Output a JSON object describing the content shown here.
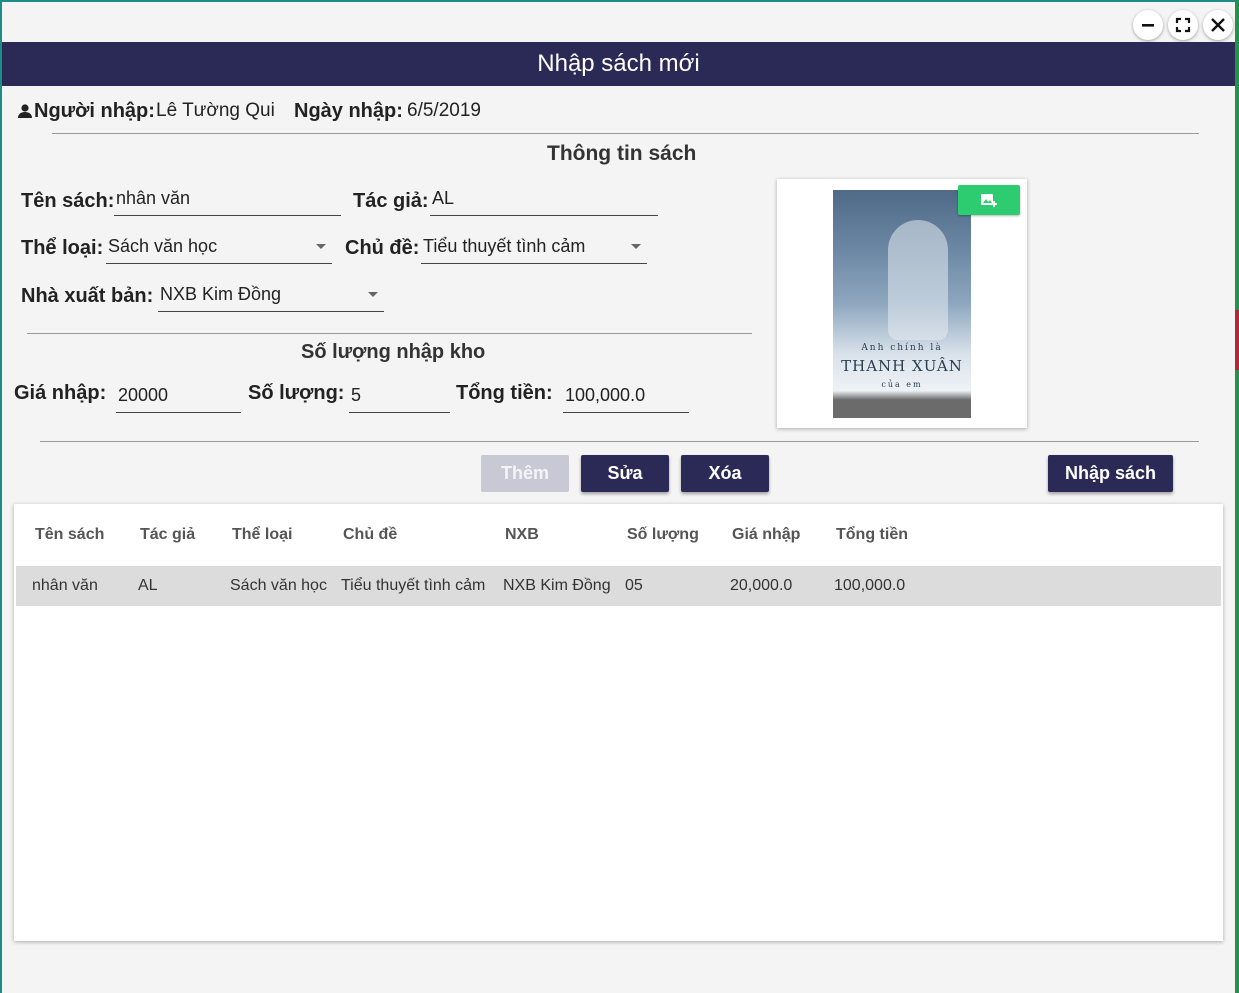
{
  "window": {
    "title": "Nhập sách mới",
    "controls": [
      "minimize-icon",
      "maximize-icon",
      "close-icon"
    ]
  },
  "importer": {
    "label": "Người nhập:",
    "name": "Lê Tường Qui",
    "date_label": "Ngày nhập:",
    "date": "6/5/2019"
  },
  "book_info": {
    "section_title": "Thông tin sách",
    "title_label": "Tên sách:",
    "title_value": "nhân văn",
    "author_label": "Tác giả:",
    "author_value": "AL",
    "genre_label": "Thể loại:",
    "genre_value": "Sách văn học",
    "topic_label": "Chủ đề:",
    "topic_value": "Tiểu thuyết tình cảm",
    "publisher_label": "Nhà xuất bản:",
    "publisher_value": "NXB Kim Đồng"
  },
  "stock": {
    "section_title": "Số lượng nhập kho",
    "price_label": "Giá nhập:",
    "price_value": "20000",
    "qty_label": "Số lượng:",
    "qty_value": "5",
    "total_label": "Tổng tiền:",
    "total_value": "100,000.0"
  },
  "cover": {
    "line1": "Anh chính là",
    "line2": "THANH XUÂN",
    "line3": "của em"
  },
  "buttons": {
    "add": "Thêm",
    "edit": "Sửa",
    "delete": "Xóa",
    "import": "Nhập sách"
  },
  "table": {
    "headers": [
      "Tên sách",
      "Tác giả",
      "Thể loại",
      "Chủ đề",
      "NXB",
      "Số lượng",
      "Giá nhập",
      "Tổng tiền"
    ],
    "rows": [
      [
        "nhân văn",
        "AL",
        "Sách văn học",
        "Tiểu thuyết tình cảm",
        "NXB Kim Đồng",
        "05",
        "20,000.0",
        "100,000.0"
      ]
    ]
  },
  "colors": {
    "header_bg": "#2b2a57",
    "button_dark": "#2b2a57",
    "add_image_green": "#2ecc71",
    "selected_row": "#dcdcdc"
  }
}
